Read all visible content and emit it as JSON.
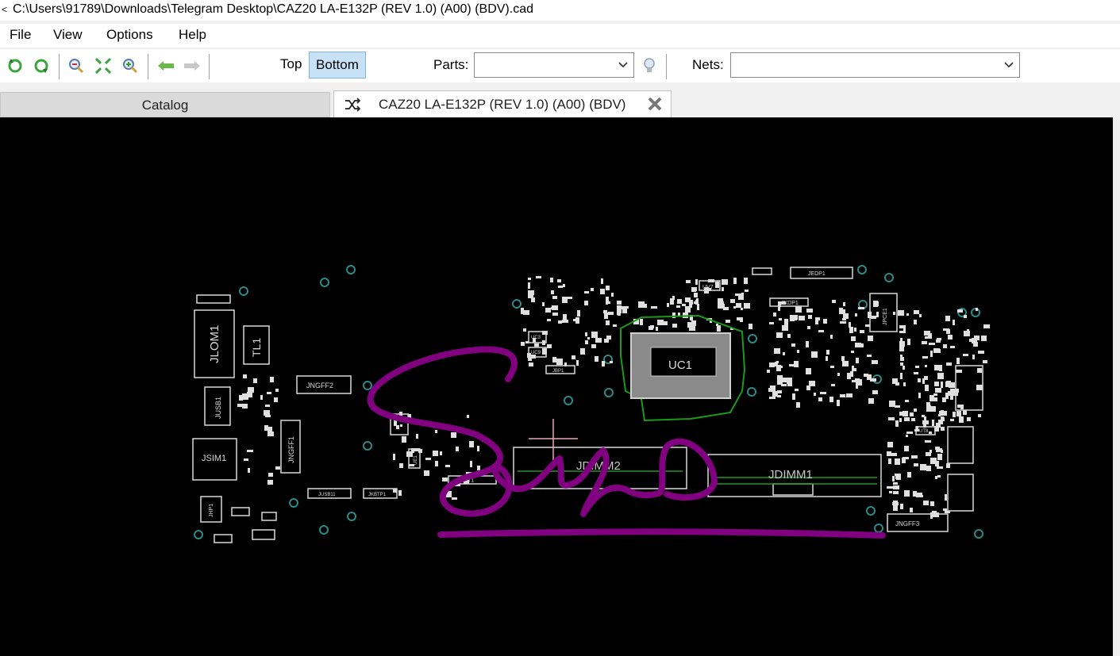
{
  "window": {
    "title": "C:\\Users\\91789\\Downloads\\Telegram Desktop\\CAZ20 LA-E132P (REV 1.0) (A00) (BDV).cad"
  },
  "menu": [
    "File",
    "View",
    "Options",
    "Help"
  ],
  "toolbar": {
    "side_top": "Top",
    "side_bottom": "Bottom",
    "parts_label": "Parts:",
    "parts_value": "",
    "nets_label": "Nets:",
    "nets_value": ""
  },
  "tabs": {
    "catalog": "Catalog",
    "board": "CAZ20 LA-E132P (REV 1.0) (A00) (BDV)"
  },
  "board": {
    "labels": [
      "JLOM1",
      "TL1",
      "JUSB1",
      "JSIM1",
      "JHP1",
      "JNGFF2",
      "JNGFF1",
      "UC1",
      "JDIMM2",
      "JDIMM1",
      "JEDP1",
      "JXDP1",
      "UV7",
      "JBP1",
      "JUSB11",
      "JKBTP1",
      "JNGFF3",
      "JDIMM1",
      "UT8",
      "UC3",
      "UC9",
      "JPCE1",
      "UE1",
      "UAT1"
    ]
  },
  "colors": {
    "canvas_bg": "#000000",
    "silkscreen": "#d8d8d8",
    "copper_outline": "#1a9a1a",
    "via": "#2a8a8a",
    "signature_ink": "#800080"
  }
}
